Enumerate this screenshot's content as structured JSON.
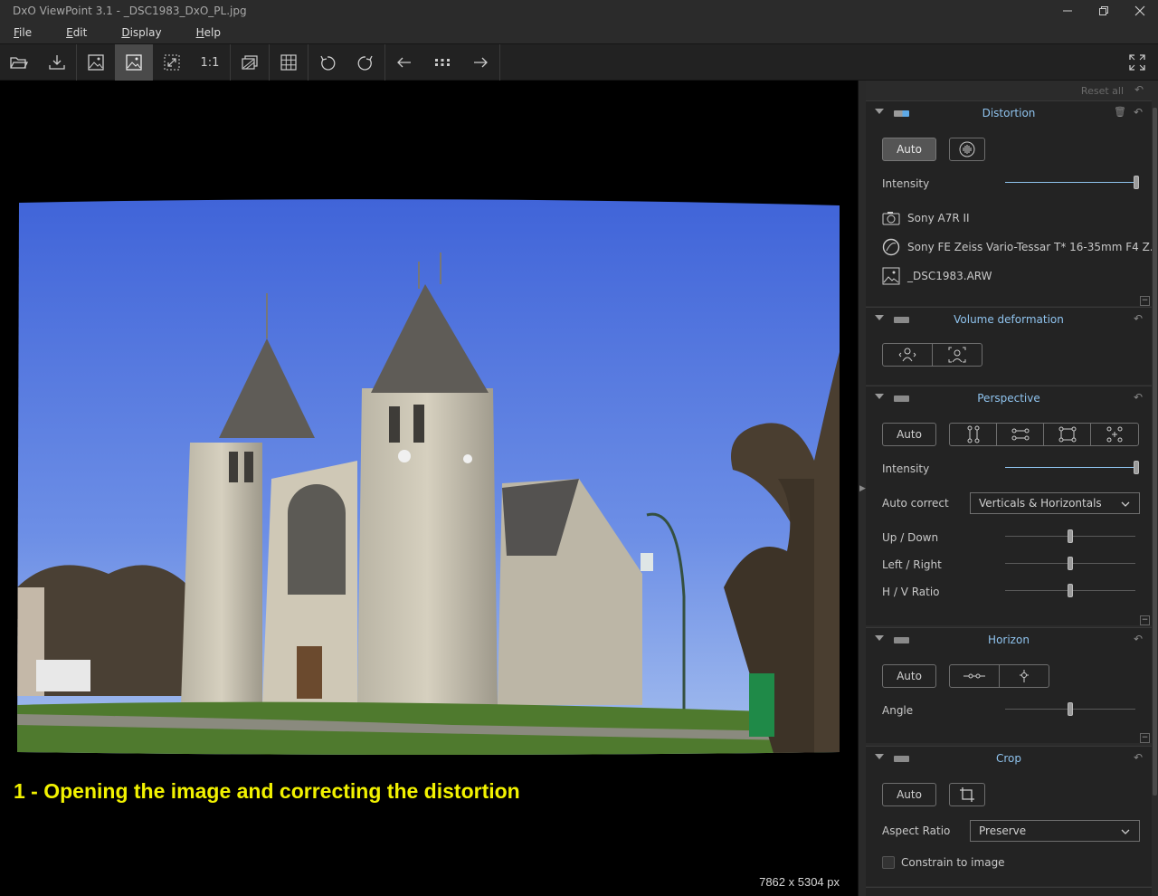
{
  "window": {
    "title": "DxO ViewPoint 3.1 - _DSC1983_DxO_PL.jpg"
  },
  "menu": [
    {
      "label": "File",
      "accel": "F",
      "rest": "ile"
    },
    {
      "label": "Edit",
      "accel": "E",
      "rest": "dit"
    },
    {
      "label": "Display",
      "accel": "D",
      "rest": "isplay"
    },
    {
      "label": "Help",
      "accel": "H",
      "rest": "elp"
    }
  ],
  "toolbar": {
    "zoom_label": "1:1"
  },
  "viewer": {
    "caption": "1 - Opening the image and correcting the distortion",
    "dimensions": "7862 x 5304 px"
  },
  "panel": {
    "reset_all": "Reset all",
    "distortion": {
      "title": "Distortion",
      "auto_label": "Auto",
      "intensity_label": "Intensity",
      "intensity_value": 1.0,
      "camera": "Sony A7R II",
      "lens": "Sony FE Zeiss Vario-Tessar T* 16-35mm F4 Z...",
      "file": "_DSC1983.ARW"
    },
    "volume": {
      "title": "Volume deformation"
    },
    "perspective": {
      "title": "Perspective",
      "auto_label": "Auto",
      "intensity_label": "Intensity",
      "intensity_value": 1.0,
      "auto_correct_label": "Auto correct",
      "auto_correct_value": "Verticals & Horizontals",
      "updown_label": "Up / Down",
      "updown_value": 0.5,
      "leftright_label": "Left / Right",
      "leftright_value": 0.5,
      "hvratio_label": "H / V Ratio",
      "hvratio_value": 0.5
    },
    "horizon": {
      "title": "Horizon",
      "auto_label": "Auto",
      "angle_label": "Angle",
      "angle_value": 0.5
    },
    "crop": {
      "title": "Crop",
      "auto_label": "Auto",
      "aspect_label": "Aspect Ratio",
      "aspect_value": "Preserve",
      "constrain_label": "Constrain to image"
    }
  }
}
